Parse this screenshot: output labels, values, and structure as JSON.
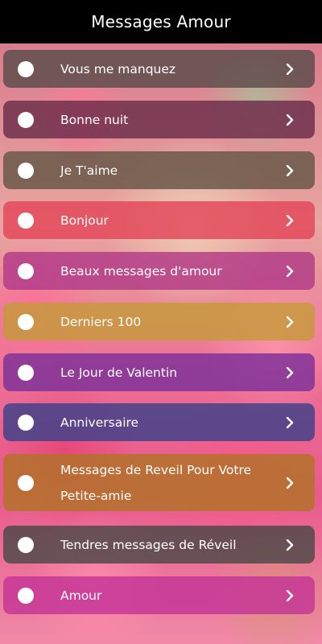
{
  "header": {
    "title": "Messages Amour"
  },
  "menu": {
    "items": [
      {
        "label": "Vous me manquez",
        "color": "#5a4c4a"
      },
      {
        "label": "Bonne nuit",
        "color": "#6b2c4a"
      },
      {
        "label": "Je T'aime",
        "color": "#655646"
      },
      {
        "label": "Bonjour",
        "color": "#e34558"
      },
      {
        "label": "Beaux messages d'amour",
        "color": "#b13a88"
      },
      {
        "label": "Derniers 100",
        "color": "#c69a39"
      },
      {
        "label": "Le Jour de Valentin",
        "color": "#7d2f9a"
      },
      {
        "label": "Anniversaire",
        "color": "#3d4189"
      },
      {
        "label": "Messages de Reveil Pour Votre Petite-amie",
        "color": "#b17326"
      },
      {
        "label": "Tendres messages de Réveil",
        "color": "#4c4848"
      },
      {
        "label": "Amour",
        "color": "#c43596"
      }
    ]
  },
  "icons": {
    "bullet": "circle-icon",
    "chevron": "chevron-right-icon"
  }
}
